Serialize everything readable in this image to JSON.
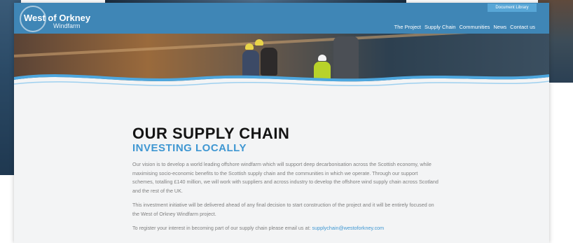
{
  "site": {
    "logo_title": "West of Orkney",
    "logo_subtitle": "Windfarm",
    "document_library": "Document Library"
  },
  "nav": {
    "items": [
      {
        "label": "The Project"
      },
      {
        "label": "Supply Chain"
      },
      {
        "label": "Communities"
      },
      {
        "label": "News"
      },
      {
        "label": "Contact us"
      }
    ]
  },
  "main": {
    "title": "OUR SUPPLY CHAIN",
    "subtitle": "INVESTING LOCALLY",
    "paragraph1": "Our vision is to develop a world leading offshore windfarm which will support deep decarbonisation across the Scottish economy, while maximising socio-economic benefits to the Scottish supply chain and the communities in which we operate. Through our support schemes, totalling £140 million, we will work with suppliers and across industry to develop the offshore wind supply chain across Scotland and the rest of the UK.",
    "paragraph2": "This investment initiative will be delivered ahead of any final decision to start construction of the project and it will be entirely focused on the West of Orkney Windfarm project.",
    "paragraph3_prefix": "To register your interest in becoming part of our supply chain please email us at: ",
    "email": "supplychain@westoforkney.com"
  },
  "colors": {
    "header": "#3f86b6",
    "accent": "#3f97d2",
    "heading": "#141414",
    "body_text": "#7f7f7f",
    "background": "#f3f4f5"
  }
}
